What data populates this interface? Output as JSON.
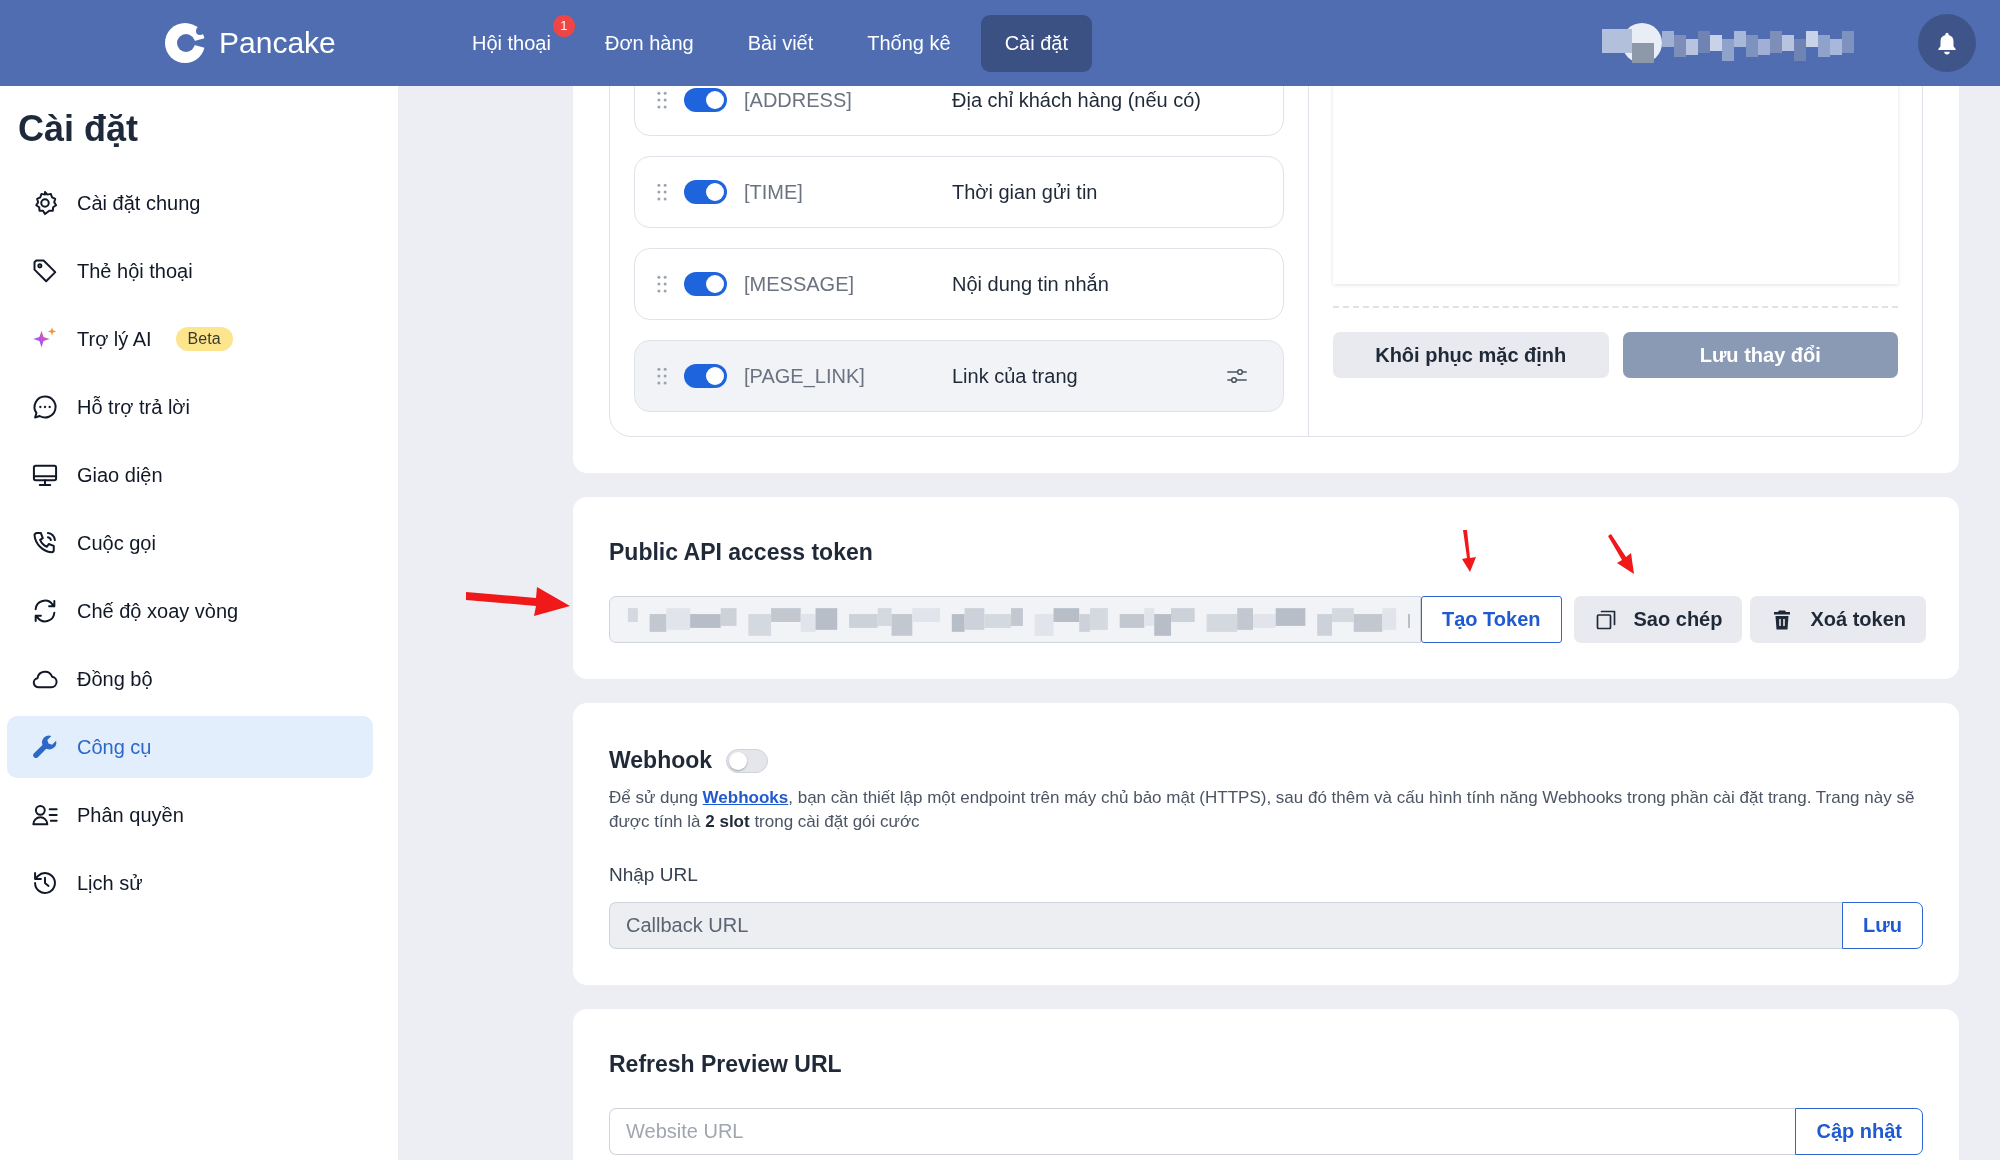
{
  "header": {
    "logo": "Pancake",
    "nav": [
      {
        "label": "Hội thoại",
        "selected": false,
        "badge": "1"
      },
      {
        "label": "Đơn hàng",
        "selected": false
      },
      {
        "label": "Bài viết",
        "selected": false
      },
      {
        "label": "Thống kê",
        "selected": false
      },
      {
        "label": "Cài đặt",
        "selected": true
      }
    ]
  },
  "sidebar": {
    "title": "Cài đặt",
    "items": [
      {
        "label": "Cài đặt chung",
        "selected": false
      },
      {
        "label": "Thẻ hội thoại",
        "selected": false
      },
      {
        "label": "Trợ lý AI",
        "selected": false,
        "badge": "Beta"
      },
      {
        "label": "Hỗ trợ trả lời",
        "selected": false
      },
      {
        "label": "Giao diện",
        "selected": false
      },
      {
        "label": "Cuộc gọi",
        "selected": false
      },
      {
        "label": "Chế độ xoay vòng",
        "selected": false
      },
      {
        "label": "Đồng bộ",
        "selected": false
      },
      {
        "label": "Công cụ",
        "selected": true
      },
      {
        "label": "Phân quyền",
        "selected": false
      },
      {
        "label": "Lịch sử",
        "selected": false
      }
    ]
  },
  "fields_card": {
    "rows": [
      {
        "tag": "[ADDRESS]",
        "description": "Địa chỉ khách hàng (nếu có)",
        "on": true,
        "hovered": false
      },
      {
        "tag": "[TIME]",
        "description": "Thời gian gửi tin",
        "on": true,
        "hovered": false
      },
      {
        "tag": "[MESSAGE]",
        "description": "Nội dung tin nhắn",
        "on": true,
        "hovered": false
      },
      {
        "tag": "[PAGE_LINK]",
        "description": "Link của trang",
        "on": true,
        "hovered": true
      }
    ],
    "buttons": [
      {
        "label": "Khôi phục mặc định",
        "disabled": false,
        "kind": "secondary"
      },
      {
        "label": "Lưu thay đổi",
        "disabled": true,
        "kind": "primary"
      }
    ]
  },
  "token_card": {
    "title": "Public API access token",
    "buttons": [
      {
        "label": "Tạo Token",
        "kind": "outline"
      },
      {
        "label": "Sao chép",
        "kind": "copy"
      },
      {
        "label": "Xoá token",
        "kind": "delete"
      }
    ]
  },
  "webhook_card": {
    "title": "Webhook",
    "on": false,
    "description_before": "Để sử dụng ",
    "link": "Webhooks",
    "description_after": ", bạn cần thiết lập một endpoint trên máy chủ bảo mật (HTTPS), sau đó thêm và cấu hình tính năng Webhooks trong phần cài đặt trang. Trang này sẽ được tính là **2 slot** trong cài đặt gói cước",
    "url_label": "Nhập URL",
    "placeholder": "Callback URL",
    "button": "Lưu"
  },
  "refresh_card": {
    "title": "Refresh Preview URL",
    "placeholder": "Website URL",
    "button": "Cập nhật"
  }
}
